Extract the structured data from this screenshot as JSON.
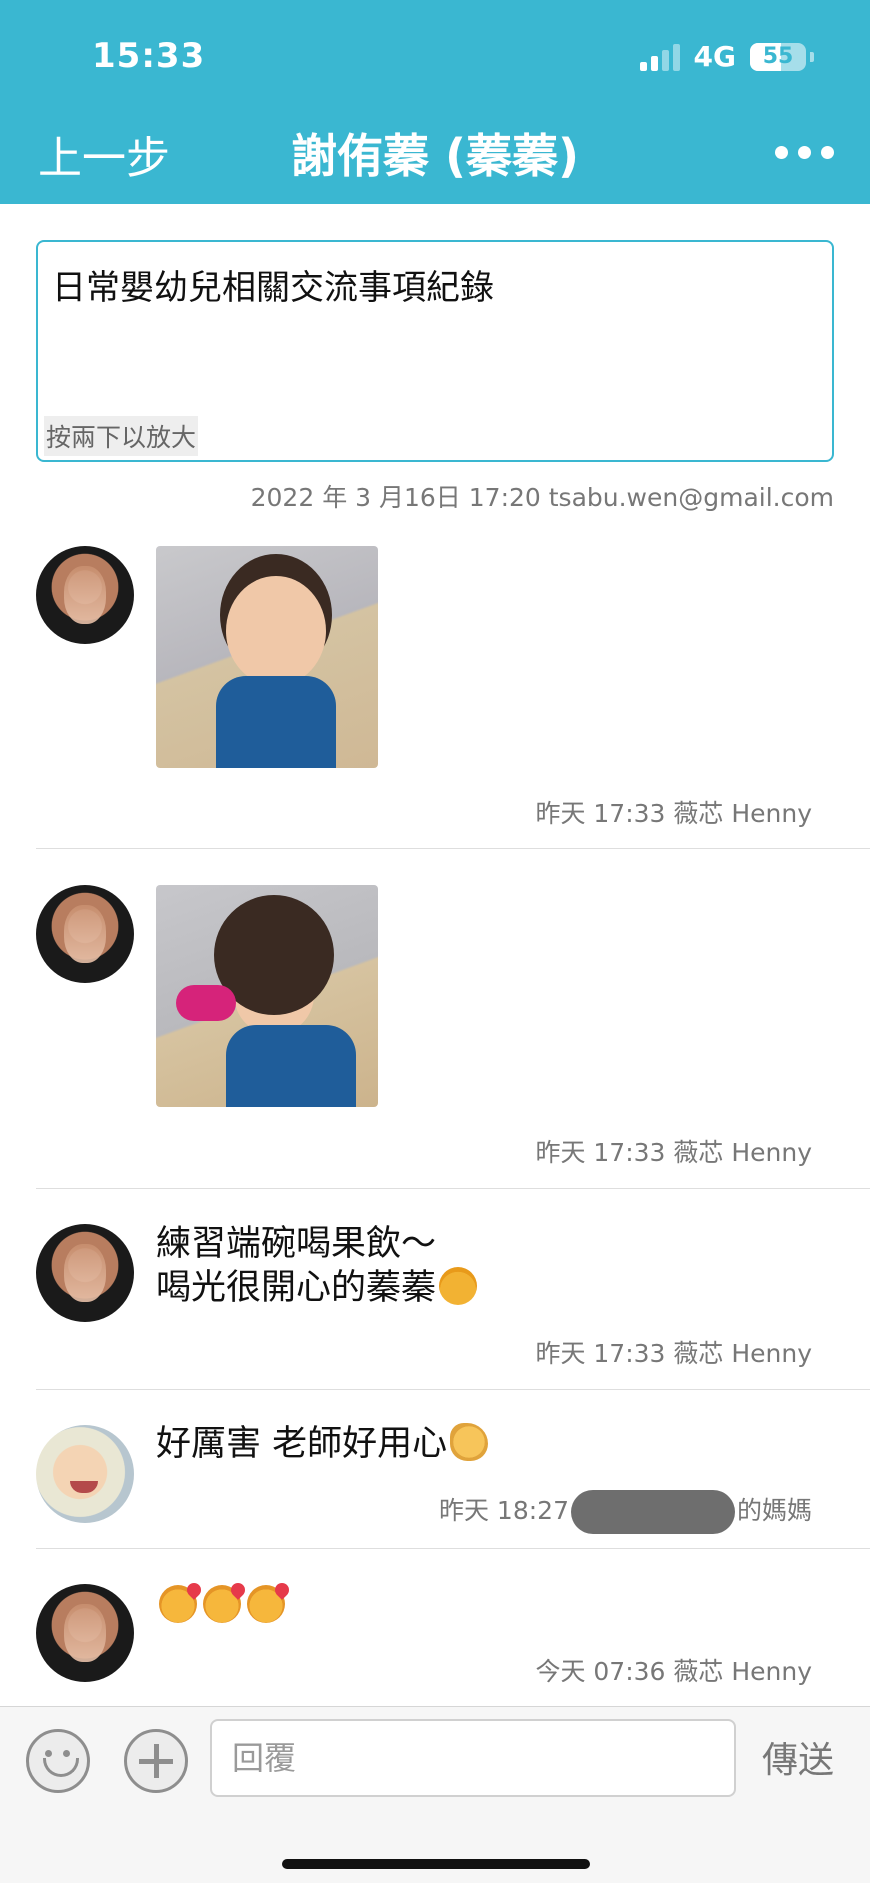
{
  "status": {
    "time": "15:33",
    "network": "4G",
    "battery": "55",
    "battery_level": 0.55
  },
  "nav": {
    "back_label": "上一步",
    "title": "謝侑蓁 (蓁蓁)"
  },
  "note": {
    "text": "日常嬰幼兒相關交流事項紀錄",
    "hint": "按兩下以放大",
    "meta": "2022 年 3 月16日 17:20 tsabu.wen@gmail.com"
  },
  "messages": [
    {
      "type": "image",
      "meta": "昨天 17:33 薇芯 Henny"
    },
    {
      "type": "image",
      "meta": "昨天 17:33 薇芯 Henny"
    },
    {
      "type": "text",
      "line1": "練習端碗喝果飲～",
      "line2": "喝光很開心的蓁蓁",
      "emoji": "smiling-face-emoji",
      "meta": "昨天 17:33 薇芯 Henny"
    },
    {
      "type": "text",
      "line1": "好厲害 老師好用心",
      "emoji": "clapping-hands-emoji",
      "meta_prefix": "昨天 18:27",
      "meta_suffix": "的媽媽"
    },
    {
      "type": "emoji",
      "emojis": [
        "smiling-face-with-hearts-emoji",
        "smiling-face-with-hearts-emoji",
        "smiling-face-with-hearts-emoji"
      ],
      "meta": "今天 07:36 薇芯 Henny"
    }
  ],
  "composer": {
    "placeholder": "回覆",
    "send_label": "傳送"
  },
  "colors": {
    "header": "#3ab7d1",
    "border_accent": "#3ab7d1",
    "meta_text": "#777777"
  }
}
